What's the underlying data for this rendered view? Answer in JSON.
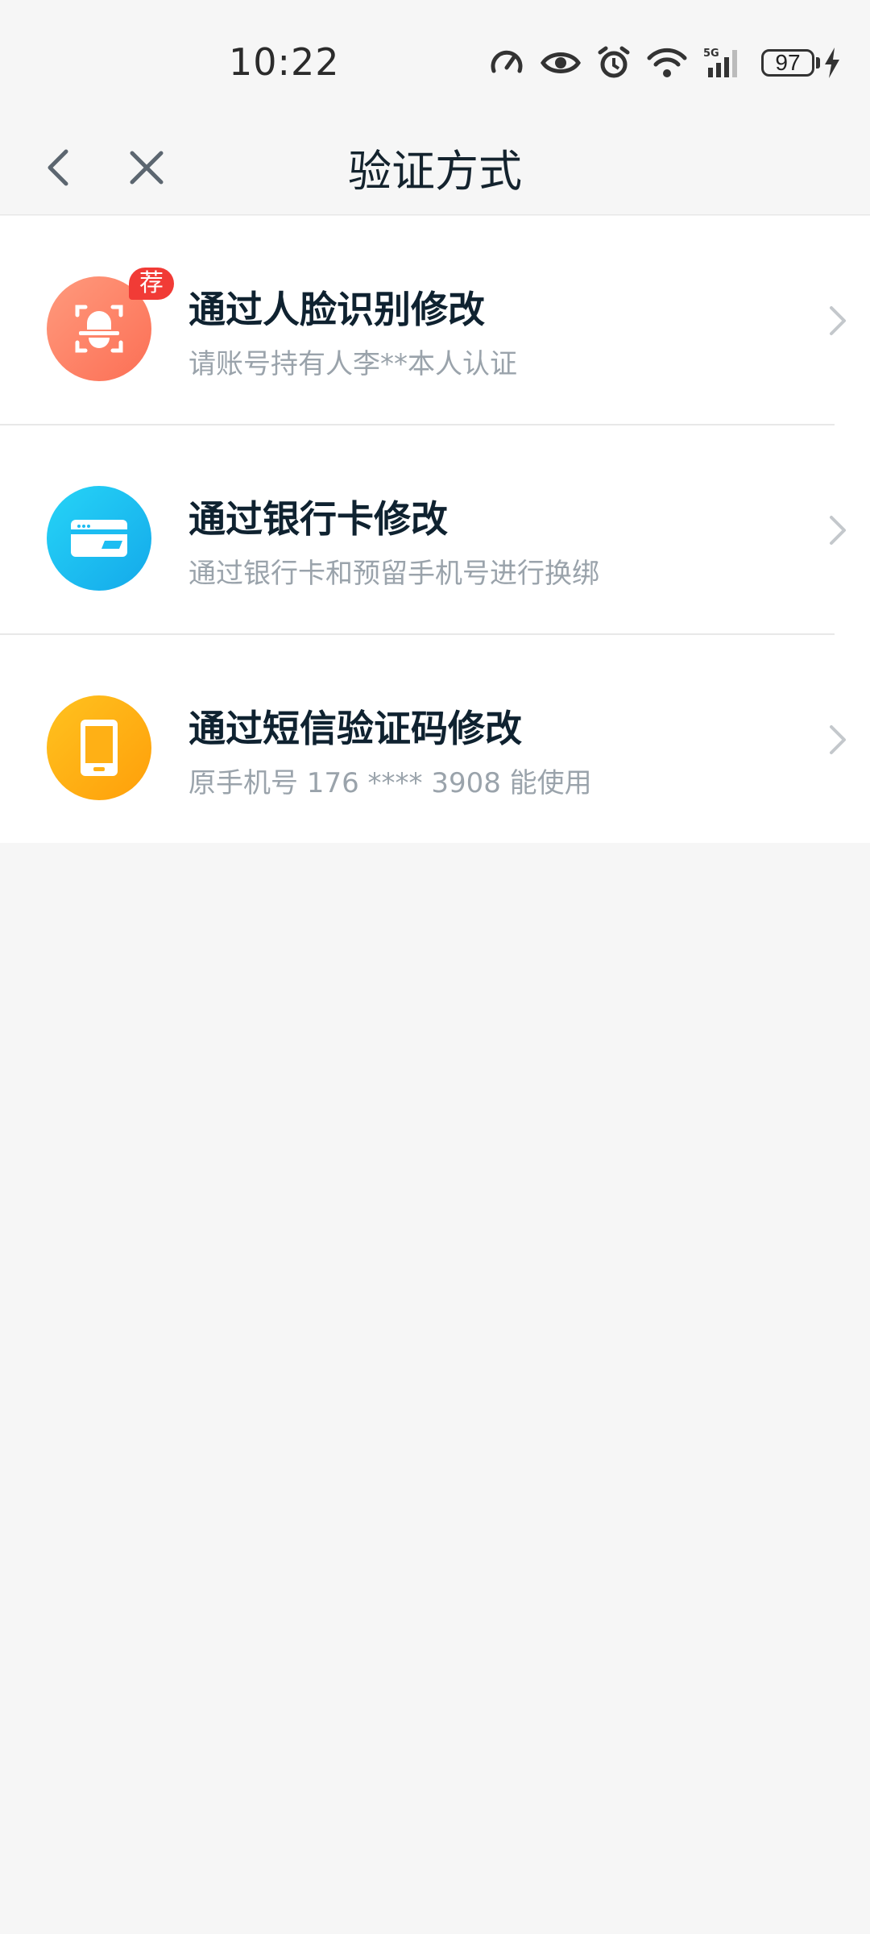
{
  "status_bar": {
    "time": "10:22",
    "battery": "97",
    "network": "5G"
  },
  "header": {
    "title": "验证方式"
  },
  "options": [
    {
      "title": "通过人脸识别修改",
      "subtitle": "请账号持有人李**本人认证",
      "badge": "荐",
      "icon": "face-scan-icon",
      "color": "#fc7a60"
    },
    {
      "title": "通过银行卡修改",
      "subtitle": "通过银行卡和预留手机号进行换绑",
      "icon": "bank-card-icon",
      "color": "#1cbdf2"
    },
    {
      "title": "通过短信验证码修改",
      "subtitle": "原手机号 176 **** 3908 能使用",
      "icon": "phone-icon",
      "color": "#ffb015"
    }
  ]
}
